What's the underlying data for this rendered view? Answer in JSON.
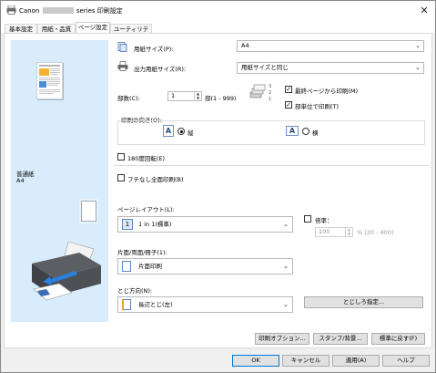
{
  "window": {
    "title_prefix": "Canon",
    "title_suffix": "series 印刷設定",
    "close_glyph": "✕"
  },
  "tabs": [
    {
      "label": "基本設定"
    },
    {
      "label": "用紙・品質"
    },
    {
      "label": "ページ設定"
    },
    {
      "label": "ユーティリティ"
    }
  ],
  "active_tab_index": 2,
  "preview": {
    "media_name": "普通紙",
    "media_size": "A4"
  },
  "page_setup": {
    "page_size_label": "用紙サイズ(P):",
    "page_size_value": "A4",
    "printer_paper_size_label": "出力用紙サイズ(R):",
    "printer_paper_size_value": "用紙サイズと同じ",
    "copies_label": "部数(C):",
    "copies_value": "1",
    "copies_range": "部(1 - 999)",
    "print_from_last_label": "最終ページから印刷(M)",
    "print_from_last_checked": true,
    "collate_label": "部単位で印刷(T)",
    "collate_checked": true,
    "orientation_label": "印刷の向き(O):",
    "orientation_portrait_label": "縦",
    "orientation_landscape_label": "横",
    "orientation_selected": "portrait",
    "rotate180_label": "180度回転(E)",
    "rotate180_checked": false,
    "borderless_label": "フチなし全面印刷(B)",
    "borderless_checked": false,
    "page_layout_label": "ページレイアウト(L):",
    "page_layout_value": "1 in 1(標準)",
    "scaling_label": "倍率：",
    "scaling_checked": false,
    "scaling_value": "100",
    "scaling_range": "% (20 - 400)",
    "duplex_label": "片面/両面/冊子(1):",
    "duplex_value": "片面印刷",
    "stapling_side_label": "とじ方向(N):",
    "stapling_side_value": "長辺とじ(左)",
    "margin_button": "とじしろ指定..."
  },
  "bottom_row": {
    "print_options": "印刷オプション...",
    "stamp_background": "スタンプ/背景...",
    "defaults": "標準に戻す(F)"
  },
  "dialog_buttons": {
    "ok": "OK",
    "cancel": "キャンセル",
    "apply": "適用(A)",
    "help": "ヘルプ"
  },
  "glyphs": {
    "check": "✓",
    "chevron": "⌄",
    "spin_up": "▲",
    "spin_down": "▼"
  },
  "colors": {
    "preview_bg": "#d8ecfb",
    "accent": "#0078d7"
  }
}
